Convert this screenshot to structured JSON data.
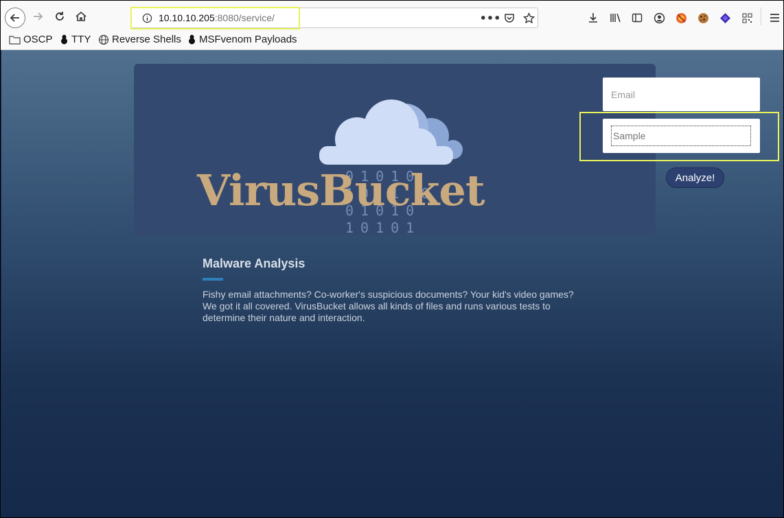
{
  "browser": {
    "url": {
      "host": "10.10.10.205",
      "rest": ":8080/service/"
    },
    "bookmarks": [
      {
        "label": "OSCP",
        "icon": "folder-icon"
      },
      {
        "label": "TTY",
        "icon": "tux-icon"
      },
      {
        "label": "Reverse Shells",
        "icon": "globe-icon"
      },
      {
        "label": "MSFvenom Payloads",
        "icon": "tux-icon"
      }
    ],
    "highlight_color": "#e9f25a"
  },
  "page": {
    "brand": "VirusBucket",
    "binary_rows": [
      "01010",
      "10 1 0",
      "01010",
      "10101"
    ],
    "email": {
      "placeholder": "Email",
      "value": ""
    },
    "sample": {
      "placeholder": "Sample",
      "value": ""
    },
    "analyze_label": "Analyze!",
    "section": {
      "title": "Malware Analysis",
      "text": "Fishy email attachments? Co-worker's suspicious documents? Your kid's video games? We got it all covered. VirusBucket allows all kinds of files and runs various tests to determine their nature and interaction."
    },
    "colors": {
      "brand": "#c9a97e",
      "banner": "#34496f",
      "accent": "#2f7fb8"
    }
  }
}
